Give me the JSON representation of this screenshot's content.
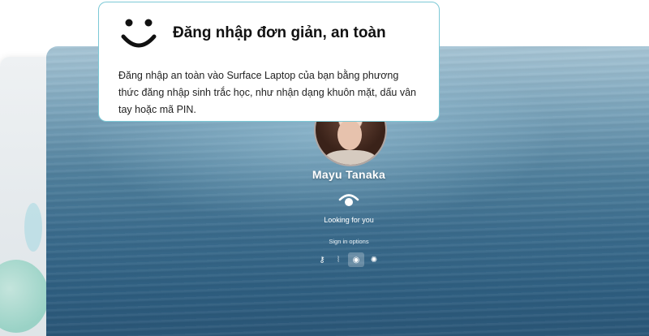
{
  "popup": {
    "title": "Đăng nhập đơn giản, an toàn",
    "description": "Đăng nhập an toàn vào Surface Laptop của bạn bằng phương thức đăng nhập sinh trắc học, như nhận dạng khuôn mặt, dấu vân tay hoặc mã PIN.",
    "icon": "smiley-icon"
  },
  "lock_screen": {
    "user_name": "Mayu Tanaka",
    "status_text": "Looking for you",
    "sign_in_options_label": "Sign in options",
    "options": [
      {
        "icon": "key-icon",
        "glyph": "⚷"
      },
      {
        "icon": "fingerprint-icon",
        "glyph": "⦚"
      },
      {
        "icon": "face-recognition-icon",
        "glyph": "◉"
      },
      {
        "icon": "security-key-icon",
        "glyph": "✺"
      }
    ],
    "selected_option": 2
  },
  "colors": {
    "popup_border": "#7cc9d6",
    "text_dark": "#111111",
    "water_dark": "#2e5e80"
  }
}
